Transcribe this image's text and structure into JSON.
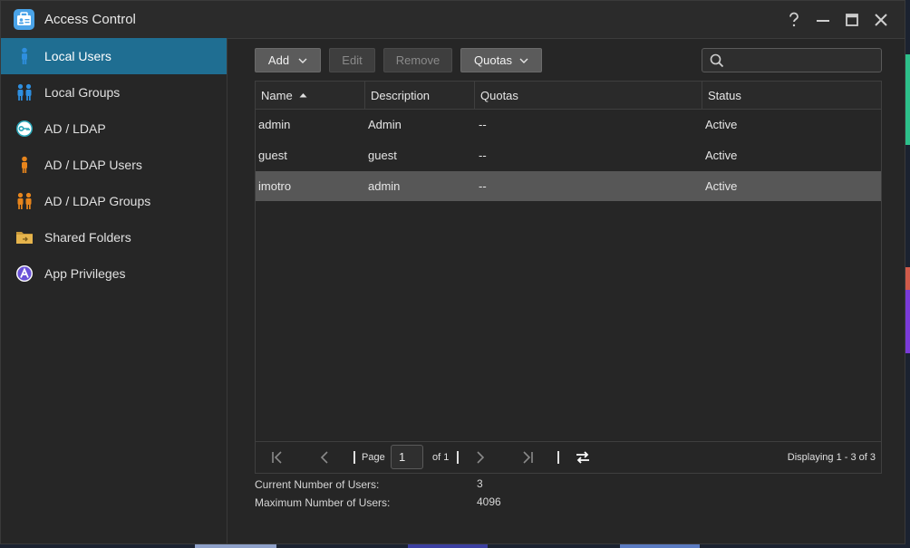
{
  "window": {
    "title": "Access Control"
  },
  "sidebar": {
    "items": [
      {
        "label": "Local Users",
        "icon": "local-user-icon",
        "active": true
      },
      {
        "label": "Local Groups",
        "icon": "local-group-icon"
      },
      {
        "label": "AD / LDAP",
        "icon": "key-icon"
      },
      {
        "label": "AD / LDAP Users",
        "icon": "domain-user-icon"
      },
      {
        "label": "AD / LDAP Groups",
        "icon": "domain-group-icon"
      },
      {
        "label": "Shared Folders",
        "icon": "folder-icon"
      },
      {
        "label": "App Privileges",
        "icon": "app-privileges-icon"
      }
    ]
  },
  "toolbar": {
    "add_label": "Add",
    "edit_label": "Edit",
    "remove_label": "Remove",
    "quotas_label": "Quotas",
    "search_placeholder": ""
  },
  "table": {
    "columns": [
      "Name",
      "Description",
      "Quotas",
      "Status"
    ],
    "sort_column": "Name",
    "sort_direction": "ascending",
    "rows": [
      {
        "name": "admin",
        "description": "Admin",
        "quotas": "--",
        "status": "Active"
      },
      {
        "name": "guest",
        "description": "guest",
        "quotas": "--",
        "status": "Active"
      },
      {
        "name": "imotro",
        "description": "admin",
        "quotas": "--",
        "status": "Active",
        "selected": true
      }
    ]
  },
  "pagination": {
    "page_label": "Page",
    "page_value": "1",
    "of_label": "of 1",
    "displaying": "Displaying 1 - 3 of 3"
  },
  "stats": {
    "current_label": "Current Number of Users:",
    "current_value": "3",
    "max_label": "Maximum Number of Users:",
    "max_value": "4096"
  },
  "colors": {
    "accent": "#1f6e92",
    "user_blue": "#2e8fe0",
    "user_orange": "#e8851c",
    "privileges_purple": "#6a52d8",
    "selected_row": "#575757"
  }
}
